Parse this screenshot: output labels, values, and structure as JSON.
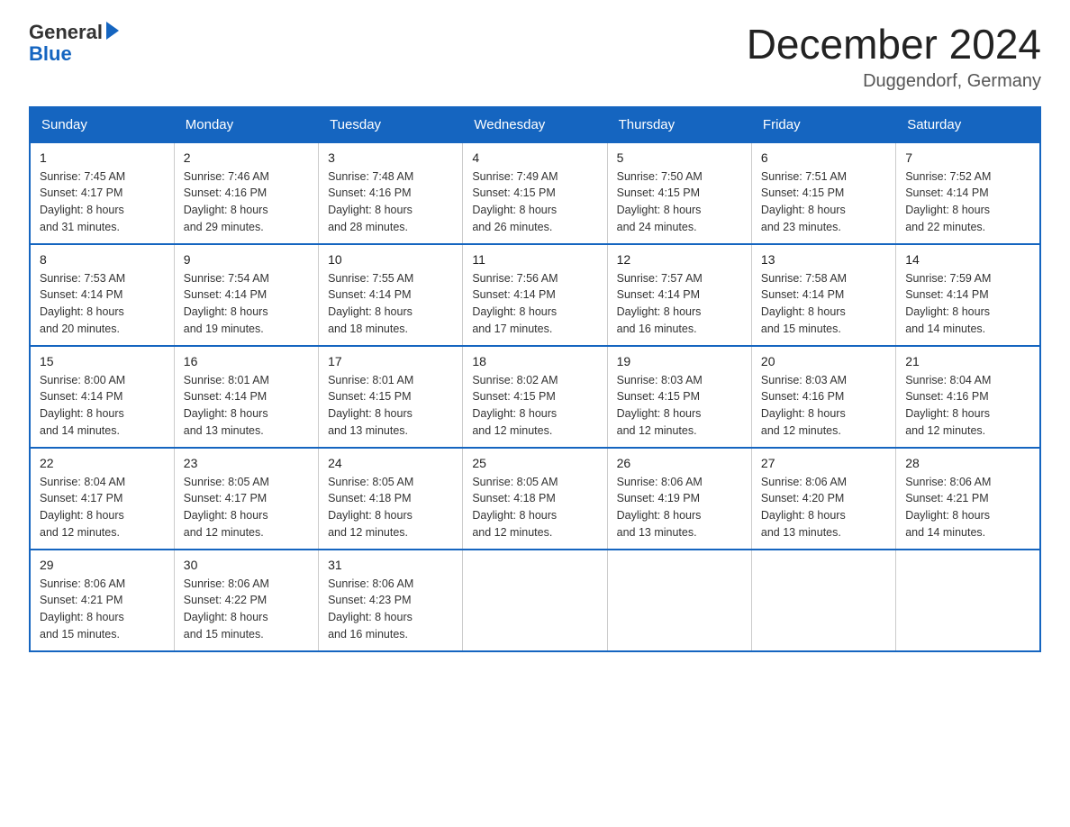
{
  "logo": {
    "general": "General",
    "blue": "Blue"
  },
  "title": "December 2024",
  "subtitle": "Duggendorf, Germany",
  "days_of_week": [
    "Sunday",
    "Monday",
    "Tuesday",
    "Wednesday",
    "Thursday",
    "Friday",
    "Saturday"
  ],
  "weeks": [
    [
      {
        "day": "1",
        "sunrise": "7:45 AM",
        "sunset": "4:17 PM",
        "daylight_hours": "8",
        "daylight_minutes": "31"
      },
      {
        "day": "2",
        "sunrise": "7:46 AM",
        "sunset": "4:16 PM",
        "daylight_hours": "8",
        "daylight_minutes": "29"
      },
      {
        "day": "3",
        "sunrise": "7:48 AM",
        "sunset": "4:16 PM",
        "daylight_hours": "8",
        "daylight_minutes": "28"
      },
      {
        "day": "4",
        "sunrise": "7:49 AM",
        "sunset": "4:15 PM",
        "daylight_hours": "8",
        "daylight_minutes": "26"
      },
      {
        "day": "5",
        "sunrise": "7:50 AM",
        "sunset": "4:15 PM",
        "daylight_hours": "8",
        "daylight_minutes": "24"
      },
      {
        "day": "6",
        "sunrise": "7:51 AM",
        "sunset": "4:15 PM",
        "daylight_hours": "8",
        "daylight_minutes": "23"
      },
      {
        "day": "7",
        "sunrise": "7:52 AM",
        "sunset": "4:14 PM",
        "daylight_hours": "8",
        "daylight_minutes": "22"
      }
    ],
    [
      {
        "day": "8",
        "sunrise": "7:53 AM",
        "sunset": "4:14 PM",
        "daylight_hours": "8",
        "daylight_minutes": "20"
      },
      {
        "day": "9",
        "sunrise": "7:54 AM",
        "sunset": "4:14 PM",
        "daylight_hours": "8",
        "daylight_minutes": "19"
      },
      {
        "day": "10",
        "sunrise": "7:55 AM",
        "sunset": "4:14 PM",
        "daylight_hours": "8",
        "daylight_minutes": "18"
      },
      {
        "day": "11",
        "sunrise": "7:56 AM",
        "sunset": "4:14 PM",
        "daylight_hours": "8",
        "daylight_minutes": "17"
      },
      {
        "day": "12",
        "sunrise": "7:57 AM",
        "sunset": "4:14 PM",
        "daylight_hours": "8",
        "daylight_minutes": "16"
      },
      {
        "day": "13",
        "sunrise": "7:58 AM",
        "sunset": "4:14 PM",
        "daylight_hours": "8",
        "daylight_minutes": "15"
      },
      {
        "day": "14",
        "sunrise": "7:59 AM",
        "sunset": "4:14 PM",
        "daylight_hours": "8",
        "daylight_minutes": "14"
      }
    ],
    [
      {
        "day": "15",
        "sunrise": "8:00 AM",
        "sunset": "4:14 PM",
        "daylight_hours": "8",
        "daylight_minutes": "14"
      },
      {
        "day": "16",
        "sunrise": "8:01 AM",
        "sunset": "4:14 PM",
        "daylight_hours": "8",
        "daylight_minutes": "13"
      },
      {
        "day": "17",
        "sunrise": "8:01 AM",
        "sunset": "4:15 PM",
        "daylight_hours": "8",
        "daylight_minutes": "13"
      },
      {
        "day": "18",
        "sunrise": "8:02 AM",
        "sunset": "4:15 PM",
        "daylight_hours": "8",
        "daylight_minutes": "12"
      },
      {
        "day": "19",
        "sunrise": "8:03 AM",
        "sunset": "4:15 PM",
        "daylight_hours": "8",
        "daylight_minutes": "12"
      },
      {
        "day": "20",
        "sunrise": "8:03 AM",
        "sunset": "4:16 PM",
        "daylight_hours": "8",
        "daylight_minutes": "12"
      },
      {
        "day": "21",
        "sunrise": "8:04 AM",
        "sunset": "4:16 PM",
        "daylight_hours": "8",
        "daylight_minutes": "12"
      }
    ],
    [
      {
        "day": "22",
        "sunrise": "8:04 AM",
        "sunset": "4:17 PM",
        "daylight_hours": "8",
        "daylight_minutes": "12"
      },
      {
        "day": "23",
        "sunrise": "8:05 AM",
        "sunset": "4:17 PM",
        "daylight_hours": "8",
        "daylight_minutes": "12"
      },
      {
        "day": "24",
        "sunrise": "8:05 AM",
        "sunset": "4:18 PM",
        "daylight_hours": "8",
        "daylight_minutes": "12"
      },
      {
        "day": "25",
        "sunrise": "8:05 AM",
        "sunset": "4:18 PM",
        "daylight_hours": "8",
        "daylight_minutes": "12"
      },
      {
        "day": "26",
        "sunrise": "8:06 AM",
        "sunset": "4:19 PM",
        "daylight_hours": "8",
        "daylight_minutes": "13"
      },
      {
        "day": "27",
        "sunrise": "8:06 AM",
        "sunset": "4:20 PM",
        "daylight_hours": "8",
        "daylight_minutes": "13"
      },
      {
        "day": "28",
        "sunrise": "8:06 AM",
        "sunset": "4:21 PM",
        "daylight_hours": "8",
        "daylight_minutes": "14"
      }
    ],
    [
      {
        "day": "29",
        "sunrise": "8:06 AM",
        "sunset": "4:21 PM",
        "daylight_hours": "8",
        "daylight_minutes": "15"
      },
      {
        "day": "30",
        "sunrise": "8:06 AM",
        "sunset": "4:22 PM",
        "daylight_hours": "8",
        "daylight_minutes": "15"
      },
      {
        "day": "31",
        "sunrise": "8:06 AM",
        "sunset": "4:23 PM",
        "daylight_hours": "8",
        "daylight_minutes": "16"
      },
      null,
      null,
      null,
      null
    ]
  ]
}
